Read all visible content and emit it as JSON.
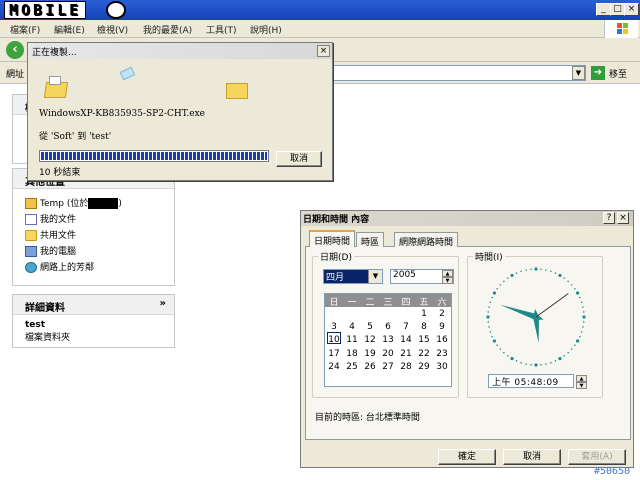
{
  "explorer": {
    "logo": "MOBILE",
    "menus": [
      "檔案(F)",
      "編輯(E)",
      "檢視(V)",
      "我的最愛(A)",
      "工具(T)",
      "說明(H)"
    ],
    "address_label": "網址",
    "go_label": "移至",
    "panel_files_title": "檔",
    "panel_places_title": "其他位置",
    "places": [
      {
        "label": "Temp (位於",
        "icon": "temp-folder-icon"
      },
      {
        "label": "我的文件",
        "icon": "my-documents-icon"
      },
      {
        "label": "共用文件",
        "icon": "shared-documents-icon"
      },
      {
        "label": "我的電腦",
        "icon": "my-computer-icon"
      },
      {
        "label": "網路上的芳鄰",
        "icon": "network-places-icon"
      }
    ],
    "places_suffix": ")",
    "details_title": "詳細資料",
    "details_chevron": "»",
    "details_name": "test",
    "details_type": "檔案資料夾"
  },
  "copy_dialog": {
    "title": "正在複製...",
    "filename": "WindowsXP-KB835935-SP2-CHT.exe",
    "from_to": "從 'Soft' 到 'test'",
    "progress": 1.0,
    "remaining": "10 秒結束",
    "cancel_label": "取消",
    "close_glyph": "×"
  },
  "datetime_dialog": {
    "title": "日期和時間 內容",
    "help_glyph": "?",
    "close_glyph": "×",
    "tabs": [
      "日期時間",
      "時區",
      "網際網路時間"
    ],
    "date_group": "日期(D)",
    "time_group": "時間(I)",
    "month": "四月",
    "year": "2005",
    "weekday_headers": [
      "日",
      "一",
      "二",
      "三",
      "四",
      "五",
      "六"
    ],
    "calendar_rows": [
      [
        "",
        "",
        "",
        "",
        "",
        "1",
        "2"
      ],
      [
        "3",
        "4",
        "5",
        "6",
        "7",
        "8",
        "9"
      ],
      [
        "10",
        "11",
        "12",
        "13",
        "14",
        "15",
        "16"
      ],
      [
        "17",
        "18",
        "19",
        "20",
        "21",
        "22",
        "23"
      ],
      [
        "24",
        "25",
        "26",
        "27",
        "28",
        "29",
        "30"
      ]
    ],
    "selected_day": "10",
    "time_value": "上午  05:48:09",
    "clock": {
      "hour": 5,
      "minute": 48,
      "second": 9
    },
    "timezone_text": "目前的時區: 台北標準時間",
    "ok_label": "確定",
    "cancel_label": "取消",
    "apply_label": "套用(A)"
  },
  "watermark": "#50650",
  "colors": {
    "titlebar": "#1a47c0",
    "progress": "#1a3fa7",
    "clock_hand": "#1f8a87",
    "selection": "#0a246a"
  }
}
